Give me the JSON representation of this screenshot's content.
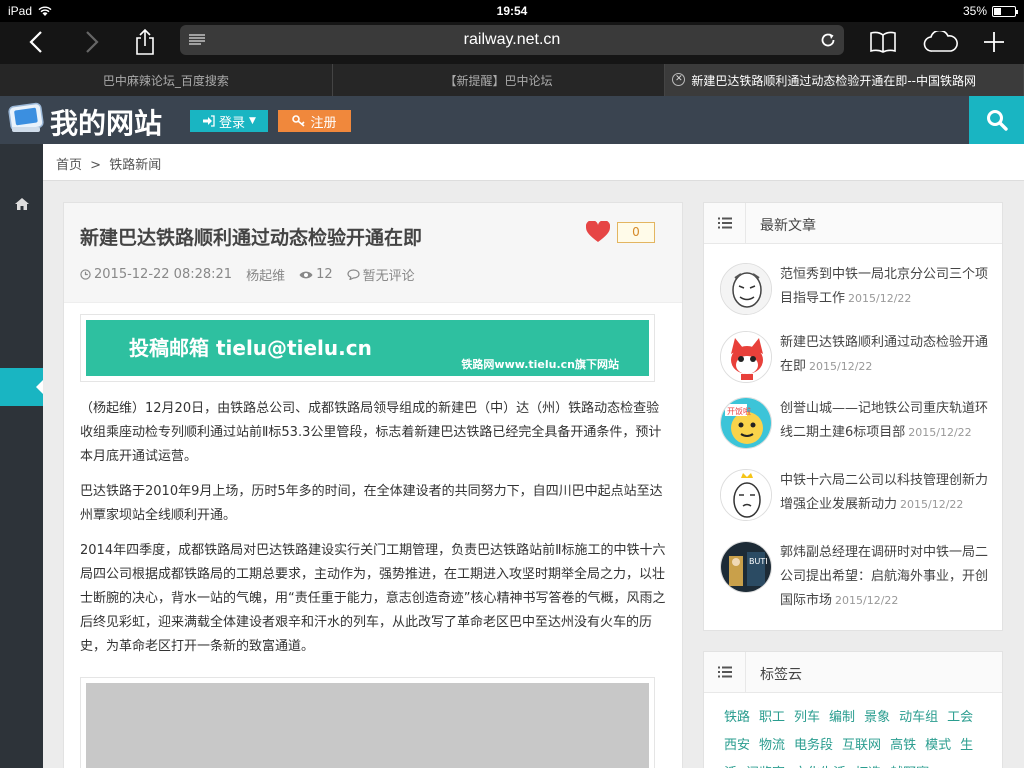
{
  "status_bar": {
    "device": "iPad",
    "time": "19:54",
    "battery": "35%",
    "battery_level": 0.35
  },
  "browser": {
    "url": "railway.net.cn",
    "tabs": [
      {
        "label": "巴中麻辣论坛_百度搜索"
      },
      {
        "label": "【新提醒】巴中论坛"
      },
      {
        "label": "新建巴达铁路顺利通过动态检验开通在即--中国铁路网"
      }
    ]
  },
  "header": {
    "site_title": "我的网站",
    "login_label": "登录",
    "register_label": "注册"
  },
  "breadcrumb": {
    "home": "首页",
    "separator": ">",
    "current": "铁路新闻"
  },
  "article": {
    "title": "新建巴达铁路顺利通过动态检验开通在即",
    "like_count": "0",
    "date": "2015-12-22 08:28:21",
    "author": "杨起维",
    "views": "12",
    "comments": "暂无评论",
    "banner_main": "投稿邮箱 tielu@tielu.cn",
    "banner_sub": "铁路网www.tielu.cn旗下网站",
    "paragraphs": [
      "（杨起维）12月20日，由铁路总公司、成都铁路局领导组成的新建巴（中）达（州）铁路动态检查验收组乘座动检专列顺利通过站前Ⅱ标53.3公里管段，标志着新建巴达铁路已经完全具备开通条件，预计本月底开通试运营。",
      "巴达铁路于2010年9月上场，历时5年多的时间，在全体建设者的共同努力下，自四川巴中起点站至达州覃家坝站全线顺利开通。",
      "2014年四季度，成都铁路局对巴达铁路建设实行关门工期管理，负责巴达铁路站前Ⅱ标施工的中铁十六局四公司根据成都铁路局的工期总要求，主动作为，强势推进，在工期进入攻坚时期举全局之力，以壮士断腕的决心，背水一站的气魄，用“责任重于能力，意志创造奇迹”核心精神书写答卷的气概，风雨之后终见彩虹，迎来满载全体建设者艰辛和汗水的列车，从此改写了革命老区巴中至达州没有火车的历史，为革命老区打开一条新的致富通道。"
    ]
  },
  "sidebar": {
    "latest_title": "最新文章",
    "latest": [
      {
        "title": "范恒秀到中铁一局北京分公司三个项目指导工作",
        "date": "2015/12/22"
      },
      {
        "title": "新建巴达铁路顺利通过动态检验开通在即",
        "date": "2015/12/22"
      },
      {
        "title": "创誉山城——记地铁公司重庆轨道环线二期土建6标项目部",
        "date": "2015/12/22"
      },
      {
        "title": "中铁十六局二公司以科技管理创新力增强企业发展新动力",
        "date": "2015/12/22"
      },
      {
        "title": "郭炜副总经理在调研时对中铁一局二公司提出希望：启航海外事业，开创国际市场",
        "date": "2015/12/22"
      }
    ],
    "tags_title": "标签云",
    "tags": [
      "铁路",
      "职工",
      "列车",
      "编制",
      "景象",
      "动车组",
      "工会",
      "西安",
      "物流",
      "电务段",
      "互联网",
      "高铁",
      "模式",
      "生活",
      "阅览室",
      "文化生活",
      "打造",
      "越野赛"
    ]
  },
  "colors": {
    "accent": "#19b5c2",
    "register": "#f0883c",
    "header_bg": "#3a4450",
    "heart": "#e64545"
  }
}
